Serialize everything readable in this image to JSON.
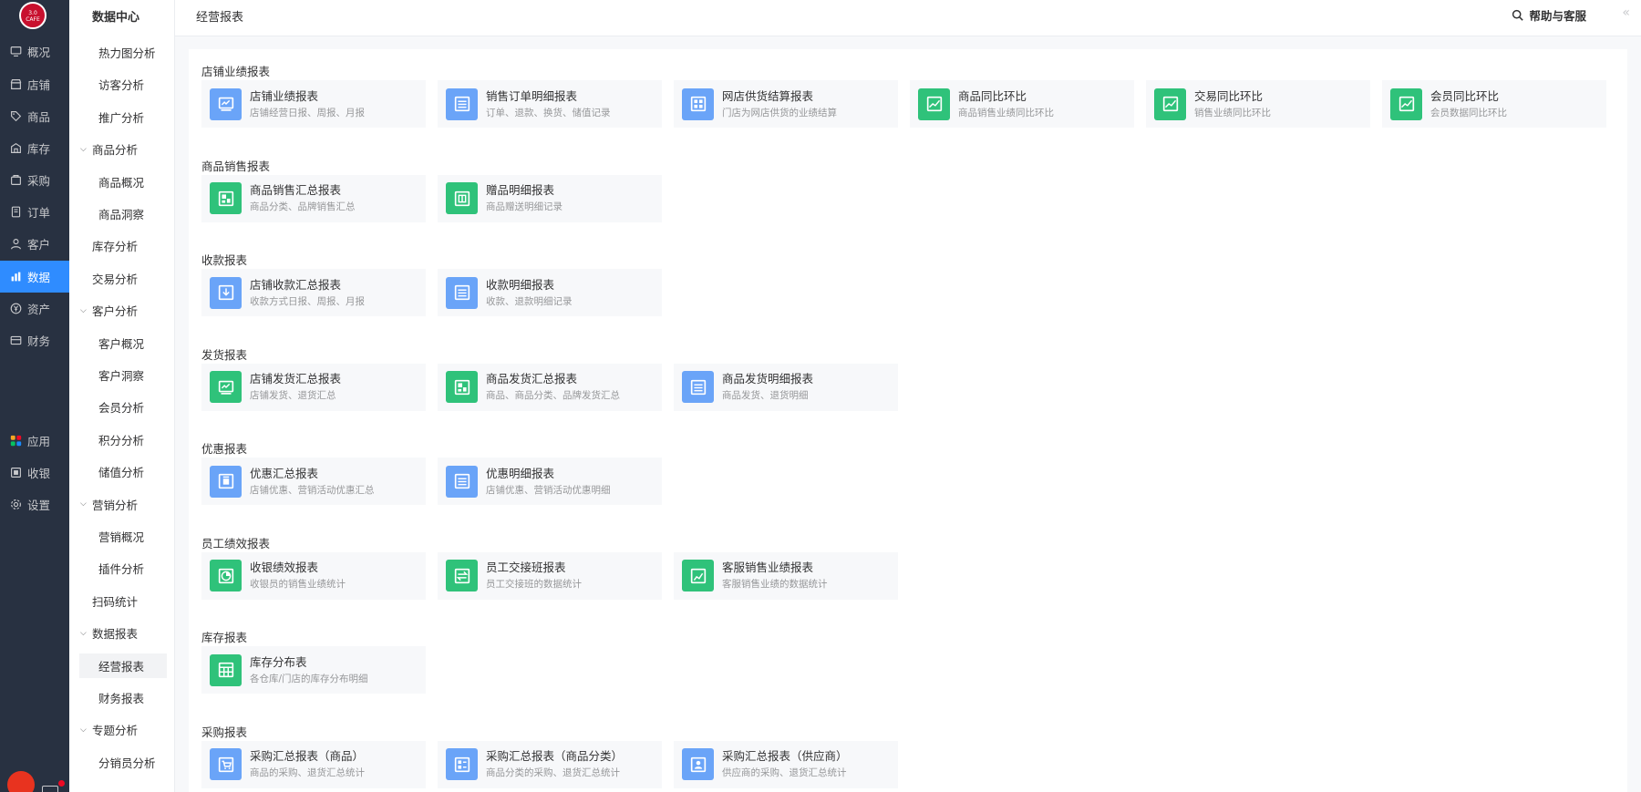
{
  "logo": {
    "text_top": "3.0",
    "text_bottom": "CAFE"
  },
  "nav_primary": [
    {
      "label": "概况",
      "icon": "monitor-icon"
    },
    {
      "label": "店铺",
      "icon": "store-icon"
    },
    {
      "label": "商品",
      "icon": "tag-icon"
    },
    {
      "label": "库存",
      "icon": "warehouse-icon"
    },
    {
      "label": "采购",
      "icon": "purchase-icon"
    },
    {
      "label": "订单",
      "icon": "order-icon"
    },
    {
      "label": "客户",
      "icon": "user-icon"
    },
    {
      "label": "数据",
      "icon": "bar-chart-icon",
      "active": true
    },
    {
      "label": "资产",
      "icon": "yen-icon"
    },
    {
      "label": "财务",
      "icon": "wallet-icon"
    },
    {
      "label": "应用",
      "icon": "apps-icon"
    },
    {
      "label": "收银",
      "icon": "cashier-icon"
    },
    {
      "label": "设置",
      "icon": "gear-icon"
    }
  ],
  "nav_secondary": {
    "title": "数据中心",
    "items": [
      {
        "label": "热力图分析",
        "level": "l2"
      },
      {
        "label": "访客分析",
        "level": "l2"
      },
      {
        "label": "推广分析",
        "level": "l2"
      },
      {
        "label": "商品分析",
        "level": "grp"
      },
      {
        "label": "商品概况",
        "level": "l2"
      },
      {
        "label": "商品洞察",
        "level": "l2"
      },
      {
        "label": "库存分析",
        "level": "l1"
      },
      {
        "label": "交易分析",
        "level": "l1"
      },
      {
        "label": "客户分析",
        "level": "grp"
      },
      {
        "label": "客户概况",
        "level": "l2"
      },
      {
        "label": "客户洞察",
        "level": "l2"
      },
      {
        "label": "会员分析",
        "level": "l2"
      },
      {
        "label": "积分分析",
        "level": "l2"
      },
      {
        "label": "储值分析",
        "level": "l2"
      },
      {
        "label": "营销分析",
        "level": "grp"
      },
      {
        "label": "营销概况",
        "level": "l2"
      },
      {
        "label": "插件分析",
        "level": "l2"
      },
      {
        "label": "扫码统计",
        "level": "l1"
      },
      {
        "label": "数据报表",
        "level": "grp"
      },
      {
        "label": "经营报表",
        "level": "sel"
      },
      {
        "label": "财务报表",
        "level": "l2"
      },
      {
        "label": "专题分析",
        "level": "grp"
      },
      {
        "label": "分销员分析",
        "level": "l2"
      }
    ]
  },
  "header": {
    "title": "经营报表",
    "help": "帮助与客服",
    "collapse": "«"
  },
  "sections": [
    {
      "title": "店铺业绩报表",
      "cards": [
        {
          "name": "店铺业绩报表",
          "desc": "店铺经营日报、周报、月报",
          "color": "blue",
          "icon": "report-icon"
        },
        {
          "name": "销售订单明细报表",
          "desc": "订单、退款、换货、储值记录",
          "color": "blue",
          "icon": "list-icon"
        },
        {
          "name": "网店供货结算报表",
          "desc": "门店为网店供货的业绩结算",
          "color": "blue",
          "icon": "grid-icon"
        },
        {
          "name": "商品同比环比",
          "desc": "商品销售业绩同比环比",
          "color": "green",
          "icon": "trend-icon"
        },
        {
          "name": "交易同比环比",
          "desc": "销售业绩同比环比",
          "color": "green",
          "icon": "trend-icon"
        },
        {
          "name": "会员同比环比",
          "desc": "会员数据同比环比",
          "color": "green",
          "icon": "trend-icon"
        }
      ]
    },
    {
      "title": "商品销售报表",
      "cards": [
        {
          "name": "商品销售汇总报表",
          "desc": "商品分类、品牌销售汇总",
          "color": "green",
          "icon": "blocks-icon"
        },
        {
          "name": "赠品明细报表",
          "desc": "商品赠送明细记录",
          "color": "green",
          "icon": "gift-icon"
        }
      ]
    },
    {
      "title": "收款报表",
      "cards": [
        {
          "name": "店铺收款汇总报表",
          "desc": "收款方式日报、周报、月报",
          "color": "blue",
          "icon": "receive-icon"
        },
        {
          "name": "收款明细报表",
          "desc": "收款、退款明细记录",
          "color": "blue",
          "icon": "list-icon"
        }
      ]
    },
    {
      "title": "发货报表",
      "cards": [
        {
          "name": "店铺发货汇总报表",
          "desc": "店铺发货、退货汇总",
          "color": "green",
          "icon": "report-icon"
        },
        {
          "name": "商品发货汇总报表",
          "desc": "商品、商品分类、品牌发货汇总",
          "color": "green",
          "icon": "blocks-icon"
        },
        {
          "name": "商品发货明细报表",
          "desc": "商品发货、退货明细",
          "color": "blue",
          "icon": "list-icon"
        }
      ]
    },
    {
      "title": "优惠报表",
      "cards": [
        {
          "name": "优惠汇总报表",
          "desc": "店铺优惠、营销活动优惠汇总",
          "color": "blue",
          "icon": "coupon-icon"
        },
        {
          "name": "优惠明细报表",
          "desc": "店铺优惠、营销活动优惠明细",
          "color": "blue",
          "icon": "list-icon"
        }
      ]
    },
    {
      "title": "员工绩效报表",
      "cards": [
        {
          "name": "收银绩效报表",
          "desc": "收银员的销售业绩统计",
          "color": "green",
          "icon": "pie-icon"
        },
        {
          "name": "员工交接班报表",
          "desc": "员工交接班的数据统计",
          "color": "green",
          "icon": "swap-icon"
        },
        {
          "name": "客服销售业绩报表",
          "desc": "客服销售业绩的数据统计",
          "color": "green",
          "icon": "chart-icon"
        }
      ]
    },
    {
      "title": "库存报表",
      "cards": [
        {
          "name": "库存分布表",
          "desc": "各仓库/门店的库存分布明细",
          "color": "green",
          "icon": "table-icon"
        }
      ]
    },
    {
      "title": "采购报表",
      "cards": [
        {
          "name": "采购汇总报表（商品）",
          "desc": "商品的采购、退货汇总统计",
          "color": "blue",
          "icon": "cart-icon"
        },
        {
          "name": "采购汇总报表（商品分类）",
          "desc": "商品分类的采购、退货汇总统计",
          "color": "blue",
          "icon": "category-icon"
        },
        {
          "name": "采购汇总报表（供应商）",
          "desc": "供应商的采购、退货汇总统计",
          "color": "blue",
          "icon": "supplier-icon"
        }
      ]
    }
  ]
}
